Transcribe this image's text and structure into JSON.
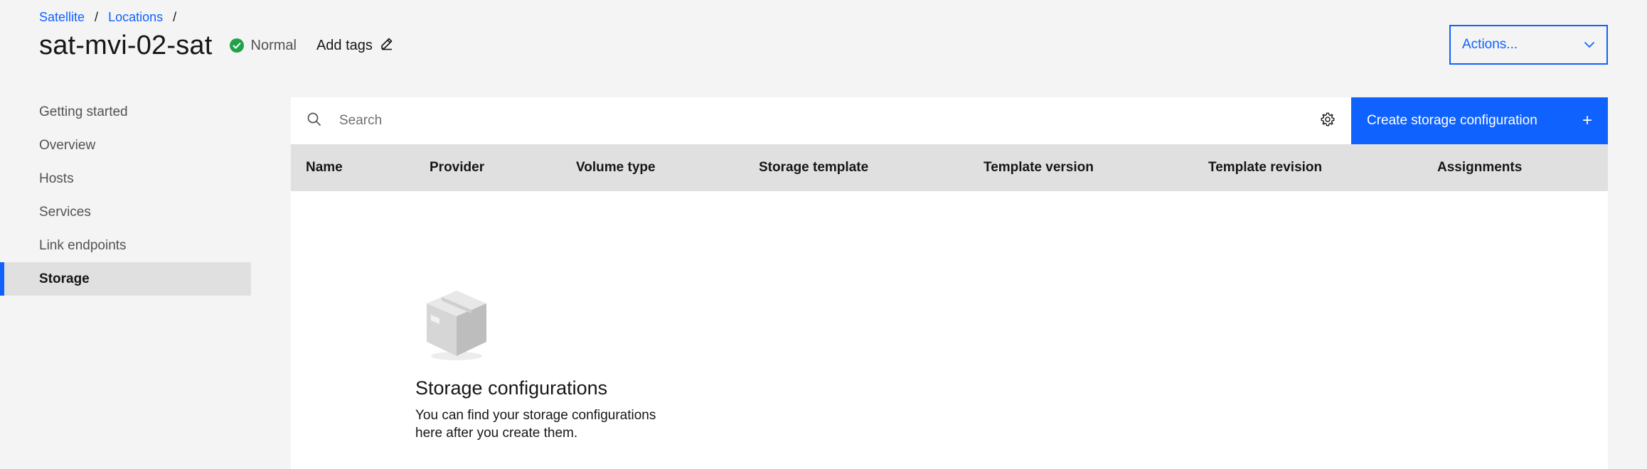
{
  "breadcrumb": {
    "items": [
      "Satellite",
      "Locations"
    ],
    "separator": "/"
  },
  "header": {
    "title": "sat-mvi-02-sat",
    "status": "Normal",
    "add_tags": "Add tags"
  },
  "actions": {
    "label": "Actions..."
  },
  "sidebar": {
    "items": [
      {
        "label": "Getting started"
      },
      {
        "label": "Overview"
      },
      {
        "label": "Hosts"
      },
      {
        "label": "Services"
      },
      {
        "label": "Link endpoints"
      },
      {
        "label": "Storage",
        "active": true
      }
    ]
  },
  "toolbar": {
    "search_placeholder": "Search",
    "create_label": "Create storage configuration",
    "create_icon": "+"
  },
  "table": {
    "columns": [
      "Name",
      "Provider",
      "Volume type",
      "Storage template",
      "Template version",
      "Template revision",
      "Assignments"
    ],
    "rows": []
  },
  "empty_state": {
    "icon": "box-icon",
    "title": "Storage configurations",
    "description_line1": "You can find your storage configurations",
    "description_line2": "here after you create them."
  },
  "colors": {
    "accent": "#0f62fe",
    "status_ok": "#24a148",
    "background": "#f4f4f4",
    "table_header": "#e0e0e0"
  }
}
